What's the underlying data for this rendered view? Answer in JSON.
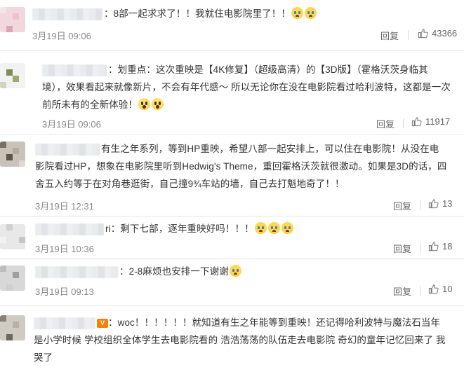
{
  "comments": [
    {
      "text": "：8部一起求求了！！我就住电影院里了！！",
      "emoji_after": [
        "cry-icon",
        "cry-icon"
      ],
      "date": "3月19日 09:06",
      "reply": "回复",
      "likes": "43366"
    },
    {
      "lines": [
        "：划重点：这次重映是【4K修复】（超级高清）的【3D版】（霍格沃茨身临其",
        "境），效果看起来就像新片，不会有年代感～ 所以无论你在没在电影院看过哈利波特，这都是一次",
        "前所未有的全新体验！"
      ],
      "emoji_after": [
        "scream-icon",
        "scream-icon"
      ],
      "date": "3月19日 09:06",
      "reply": "回复",
      "likes": "11917"
    },
    {
      "lines": [
        "有生之年系列，等到HP重映，希望八部一起安排上，可以住在电影院！从没在电",
        "影院看过HP，想象在电影院里听到Hedwig's Theme，重回霍格沃茨就很激动。如果是3D的话，四",
        "舍五入约等于在对角巷逛街，自己撞9¾车站的墙，自己去打魁地奇了！！"
      ],
      "date": "3月19日 12:31",
      "reply": "回复",
      "likes": "13"
    },
    {
      "text": "ri：剩下七部，逐年重映好吗！！！",
      "emoji_after": [
        "cry-icon",
        "cry-icon",
        "cry-icon"
      ],
      "date": "3月19日 10:36",
      "reply": "回复",
      "likes": "18"
    },
    {
      "text": "：2-8麻烦也安排一下谢谢",
      "emoji_after": [
        "cry-icon"
      ],
      "date": "3月19日 09:13",
      "reply": "回复",
      "likes": "10"
    },
    {
      "lines": [
        "：woc！！！！！！就知道有生之年能等到重映！还记得哈利波特与魔法石当年",
        "是小学时候 学校组织全体学生去电影院看的 浩浩荡荡的队伍走去电影院 奇幻的童年记忆回来了 我",
        "哭了"
      ]
    }
  ]
}
